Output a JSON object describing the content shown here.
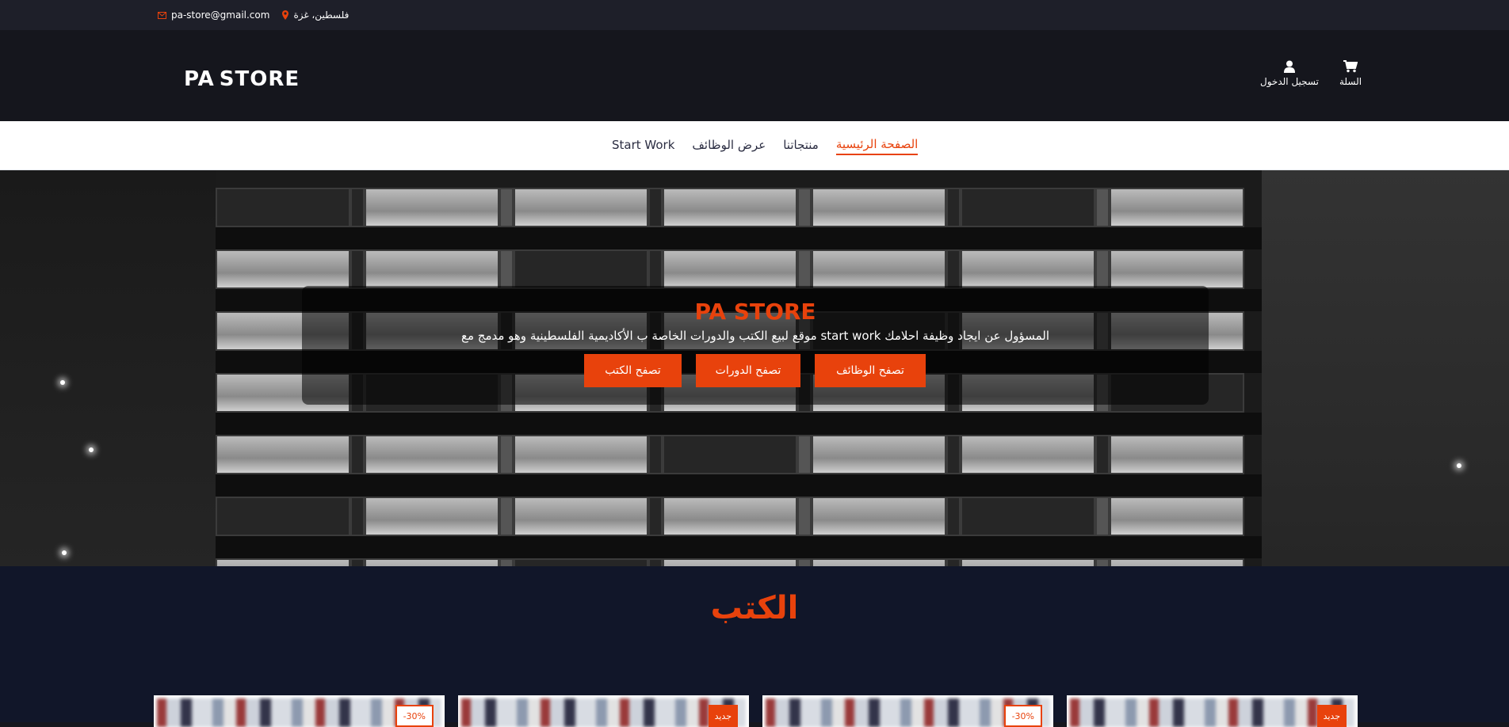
{
  "topbar": {
    "email": "pa-store@gmail.com",
    "location": "فلسطين، غزة"
  },
  "header": {
    "logo": {
      "left": "PA",
      "right": "STORE"
    },
    "login_label": "تسجيل الدخول",
    "cart_label": "السلة"
  },
  "nav": {
    "items": [
      {
        "label": "الصفحة الرئيسية",
        "active": true
      },
      {
        "label": "منتجاتنا",
        "active": false
      },
      {
        "label": "عرض الوظائف",
        "active": false
      },
      {
        "label": "Start Work",
        "active": false
      }
    ]
  },
  "hero": {
    "title": "PA STORE",
    "description": "المسؤول عن ايجاد وظيفة احلامك start work موقع لبيع الكتب والدورات الخاصة ب الأكاديمية الفلسطينية وهو مدمج مع",
    "buttons": {
      "books": "تصفح الكتب",
      "courses": "تصفح الدورات",
      "jobs": "تصفح الوظائف"
    }
  },
  "books": {
    "title": "الكتب",
    "cards": [
      {
        "badge": "-30%",
        "badge_type": "sale"
      },
      {
        "badge": "جديد",
        "badge_type": "new"
      },
      {
        "badge": "-30%",
        "badge_type": "sale"
      },
      {
        "badge": "جديد",
        "badge_type": "new"
      }
    ]
  },
  "colors": {
    "accent": "#e8420c",
    "topbar_bg": "#1e1f29",
    "header_bg": "#15161d",
    "section_bg": "#111629"
  },
  "icons": [
    "envelope-icon",
    "map-marker-icon",
    "user-icon",
    "shopping-cart-icon"
  ]
}
